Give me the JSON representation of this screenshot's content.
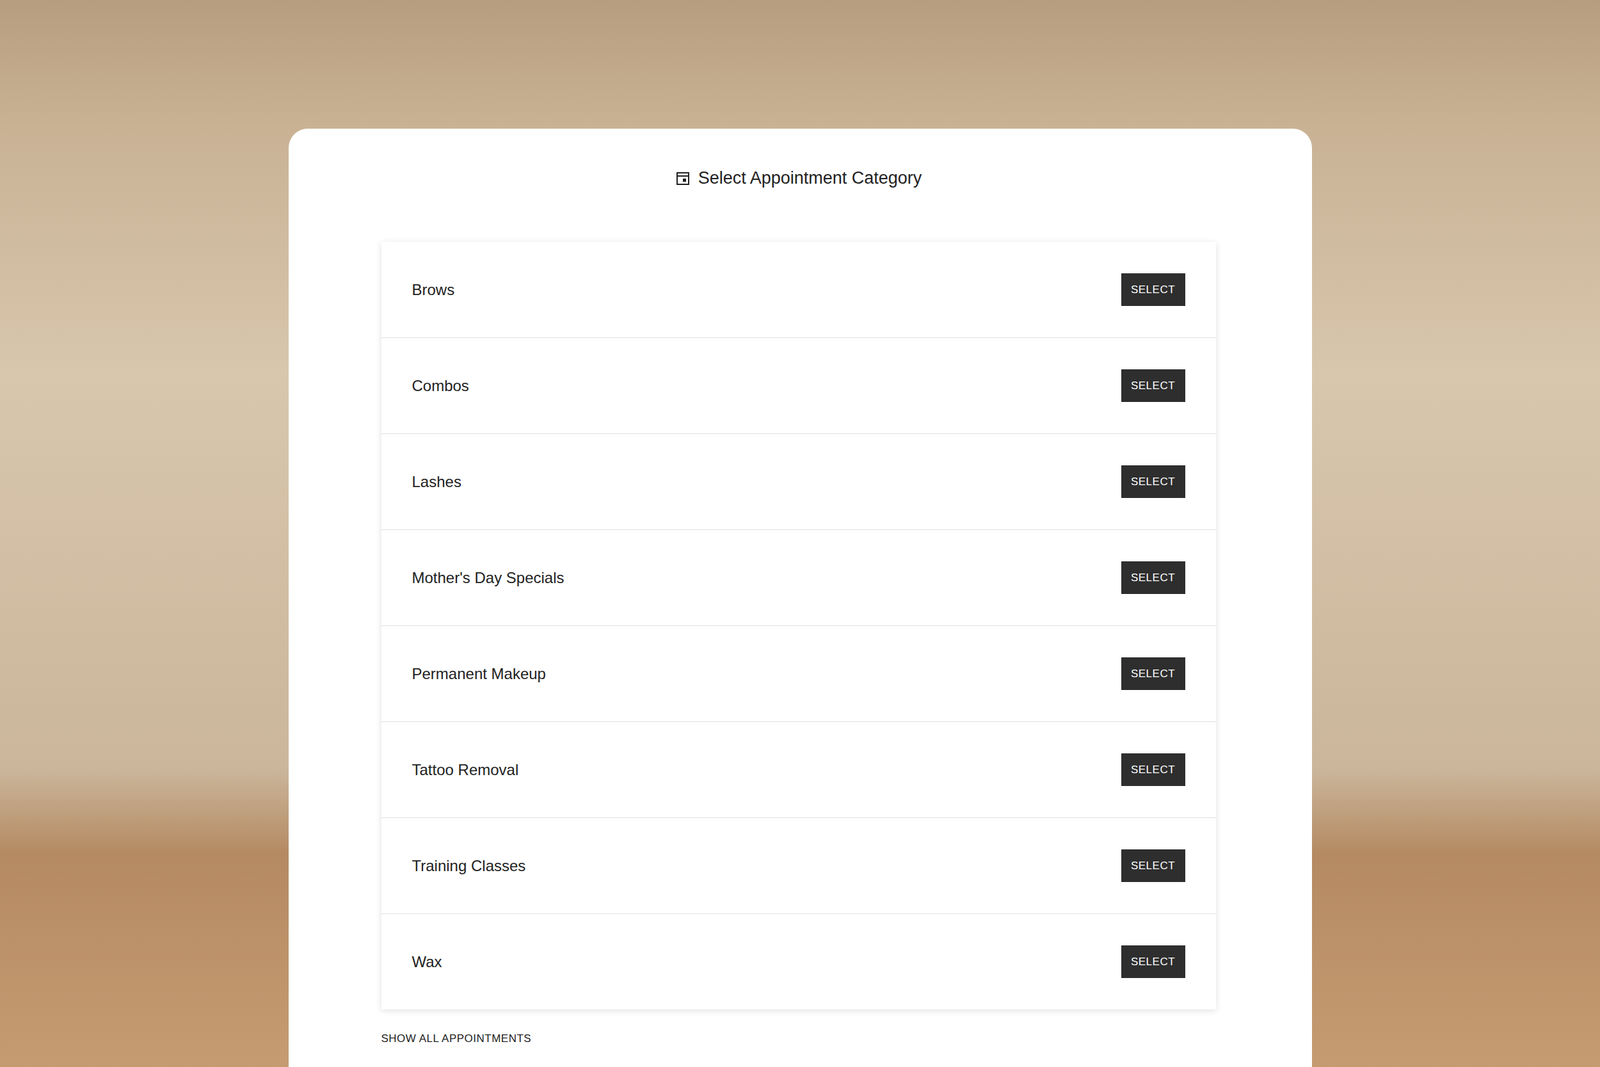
{
  "page": {
    "title": "Select Appointment Category"
  },
  "categories": [
    {
      "label": "Brows",
      "button": "SELECT"
    },
    {
      "label": "Combos",
      "button": "SELECT"
    },
    {
      "label": "Lashes",
      "button": "SELECT"
    },
    {
      "label": "Mother's Day Specials",
      "button": "SELECT"
    },
    {
      "label": "Permanent Makeup",
      "button": "SELECT"
    },
    {
      "label": "Tattoo Removal",
      "button": "SELECT"
    },
    {
      "label": "Training Classes",
      "button": "SELECT"
    },
    {
      "label": "Wax",
      "button": "SELECT"
    }
  ],
  "footer": {
    "link": "SHOW ALL APPOINTMENTS"
  }
}
